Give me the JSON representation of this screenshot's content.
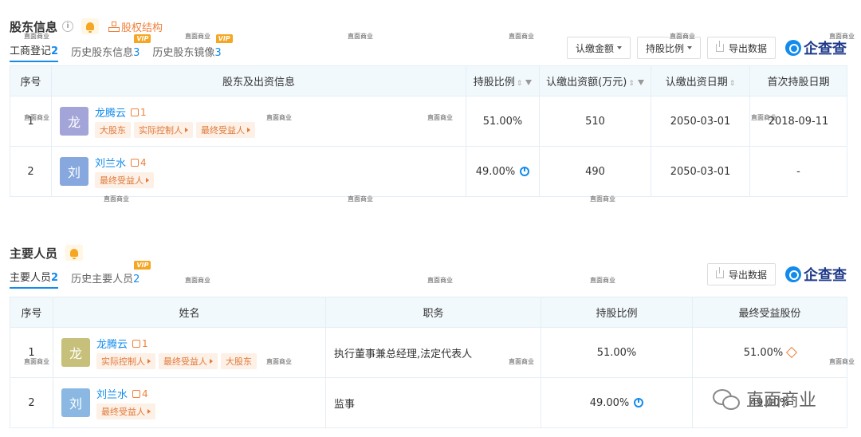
{
  "shareholders": {
    "title": "股东信息",
    "equity_link": "股权结构",
    "tabs": [
      {
        "label": "工商登记",
        "count": "2"
      },
      {
        "label": "历史股东信息",
        "count": "3"
      },
      {
        "label": "历史股东镜像",
        "count": "3"
      }
    ],
    "vip_label": "VIP",
    "toolbar": {
      "amount_btn": "认缴金额",
      "ratio_btn": "持股比例",
      "export_btn": "导出数据",
      "logo_text": "企查查"
    },
    "columns": [
      "序号",
      "股东及出资信息",
      "持股比例",
      "认缴出资额(万元)",
      "认缴出资日期",
      "首次持股日期"
    ],
    "rows": [
      {
        "index": "1",
        "avatar": "龙",
        "name": "龙腾云",
        "relations": "1",
        "tags": [
          "大股东",
          "实际控制人",
          "最终受益人"
        ],
        "ratio": "51.00%",
        "amount": "510",
        "date": "2050-03-01",
        "first_date": "2018-09-11"
      },
      {
        "index": "2",
        "avatar": "刘",
        "name": "刘兰水",
        "relations": "4",
        "tags": [
          "最终受益人"
        ],
        "ratio": "49.00%",
        "amount": "490",
        "date": "2050-03-01",
        "first_date": "-"
      }
    ]
  },
  "personnel": {
    "title": "主要人员",
    "tabs": [
      {
        "label": "主要人员",
        "count": "2"
      },
      {
        "label": "历史主要人员",
        "count": "2"
      }
    ],
    "vip_label": "VIP",
    "toolbar": {
      "export_btn": "导出数据",
      "logo_text": "企查查"
    },
    "columns": [
      "序号",
      "姓名",
      "职务",
      "持股比例",
      "最终受益股份"
    ],
    "rows": [
      {
        "index": "1",
        "avatar": "龙",
        "name": "龙腾云",
        "relations": "1",
        "tags": [
          "实际控制人",
          "最终受益人",
          "大股东"
        ],
        "position": "执行董事兼总经理,法定代表人",
        "ratio": "51.00%",
        "benefit": "51.00%"
      },
      {
        "index": "2",
        "avatar": "刘",
        "name": "刘兰水",
        "relations": "4",
        "tags": [
          "最终受益人"
        ],
        "position": "监事",
        "ratio": "49.00%",
        "benefit": "49.00%"
      }
    ]
  },
  "watermark": {
    "small": "直面商业",
    "brand": "直面商业"
  },
  "colors": {
    "accent": "#128bed",
    "orange": "#f0803c",
    "header_bg": "#f2f9fc"
  }
}
